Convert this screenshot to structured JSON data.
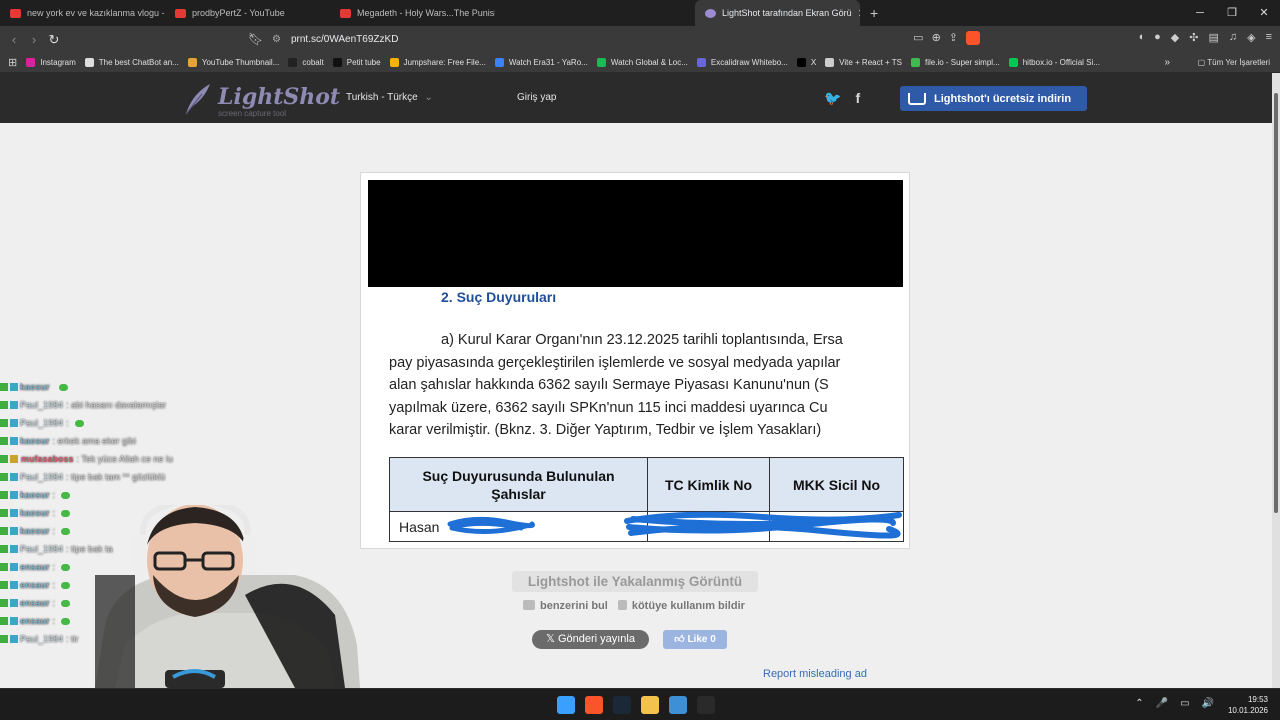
{
  "browser": {
    "tabs": [
      {
        "title": "new york ev ve kazıklanma vlogu - Yo",
        "active": false
      },
      {
        "title": "prodbyPertZ - YouTube",
        "active": false
      },
      {
        "title": "Megadeth - Holy Wars...The Punishm",
        "active": false
      },
      {
        "title": "LightShot tarafından Ekran Görü",
        "active": true
      }
    ],
    "new_tab": "+",
    "url": "prnt.sc/0WAenT69ZzKD",
    "bookmarks": [
      {
        "label": "Instagram",
        "color": "#d6249f"
      },
      {
        "label": "The best ChatBot an...",
        "color": "#dddddd"
      },
      {
        "label": "YouTube Thumbnail...",
        "color": "#e8a23a"
      },
      {
        "label": "cobalt",
        "color": "#222222"
      },
      {
        "label": "Petit tube",
        "color": "#111111"
      },
      {
        "label": "Jumpshare: Free File...",
        "color": "#f4b400"
      },
      {
        "label": "Watch Era31 - YaRo...",
        "color": "#3b82f6"
      },
      {
        "label": "Watch Global & Loc...",
        "color": "#1db954"
      },
      {
        "label": "Excalidraw Whitebo...",
        "color": "#6965db"
      },
      {
        "label": "X",
        "color": "#000000"
      },
      {
        "label": "Vite + React + TS",
        "color": "#cccccc"
      },
      {
        "label": "file.io - Super simpl...",
        "color": "#3fb950"
      },
      {
        "label": "hitbox.io - Official Si...",
        "color": "#00c853"
      }
    ],
    "bookmarks_more": "»",
    "all_bookmarks": "Tüm Yer İşaretleri"
  },
  "lightshot": {
    "logo_title": "LightShot",
    "logo_subtitle": "screen capture tool",
    "language": "Turkish - Türkçe",
    "language_arrow": "⌄",
    "login": "Giriş yap",
    "twitter": "🐦",
    "facebook": "f",
    "download_button": "Lightshot'ı ücretsiz indirin",
    "caption_title": "Lightshot ile Yakalanmış Görüntü",
    "find_similar": "benzerini bul",
    "report_abuse": "kötüye kullanım bildir",
    "tweet_button": "Gönderi yayınla",
    "tweet_icon": "𝕏",
    "like_button": "Like 0",
    "report_ad": "Report misleading ad"
  },
  "document": {
    "heading": "2.  Suç Duyuruları",
    "paragraph_lines": [
      "a)  Kurul Karar Organı'nın 23.12.2025 tarihli toplantısında, Ersa",
      "pay piyasasında gerçekleştirilen işlemlerde ve sosyal medyada yapılar",
      "alan şahıslar hakkında 6362 sayılı Sermaye Piyasası Kanunu'nun (S",
      "yapılmak üzere, 6362 sayılı SPKn'nun 115 inci maddesi uyarınca Cu",
      "karar verilmiştir. (Bknz. 3. Diğer Yaptırım, Tedbir ve İşlem Yasakları)"
    ],
    "table_headers": [
      "Suç Duyurusunda Bulunulan Şahıslar",
      "TC Kimlik No",
      "MKK Sicil No"
    ],
    "table_row_first_cell": "Hasan"
  },
  "chat": [
    {
      "user": "kaosur",
      "msg": "",
      "emote": true,
      "type": "bot"
    },
    {
      "user": "Paul_1984",
      "msg": ": abi hasanı davalamışlar",
      "emote": false,
      "type": "paul"
    },
    {
      "user": "Paul_1984",
      "msg": ":",
      "emote": true,
      "type": "paul"
    },
    {
      "user": "kaosur",
      "msg": ": erkek ama eker gibi",
      "emote": false,
      "type": "bot"
    },
    {
      "user": "mufasaboss",
      "msg": ": Tek yüce Allah ce ne lu",
      "emote": false,
      "type": "mufasa"
    },
    {
      "user": "Paul_1984",
      "msg": ": tipe bak tam ** gözlüklü",
      "emote": false,
      "type": "paul"
    },
    {
      "user": "kaosur",
      "msg": ":",
      "emote": true,
      "type": "bot"
    },
    {
      "user": "kaosur",
      "msg": ":",
      "emote": true,
      "type": "bot"
    },
    {
      "user": "kaosur",
      "msg": ":",
      "emote": true,
      "type": "bot"
    },
    {
      "user": "Paul_1984",
      "msg": ": tipe bak ta",
      "emote": false,
      "type": "paul"
    },
    {
      "user": "ensaur",
      "msg": ":",
      "emote": true,
      "type": "bot"
    },
    {
      "user": "ensaur",
      "msg": ":",
      "emote": true,
      "type": "bot"
    },
    {
      "user": "ensaur",
      "msg": ":",
      "emote": true,
      "type": "bot"
    },
    {
      "user": "ensaur",
      "msg": ":",
      "emote": true,
      "type": "bot"
    },
    {
      "user": "Paul_1984",
      "msg": ": tir",
      "emote": false,
      "type": "paul"
    }
  ],
  "taskbar": {
    "time": "19:53",
    "date": "10.01.2026",
    "apps": [
      {
        "name": "start",
        "color": "#3aa0ff"
      },
      {
        "name": "brave",
        "color": "#fb542b"
      },
      {
        "name": "steam",
        "color": "#1b2838"
      },
      {
        "name": "explorer",
        "color": "#f2c14e"
      },
      {
        "name": "photos",
        "color": "#3d8fd6"
      },
      {
        "name": "obs",
        "color": "#2a2a2a"
      }
    ],
    "tray": [
      "⌃",
      "🎤",
      "▭",
      "🔊"
    ]
  }
}
